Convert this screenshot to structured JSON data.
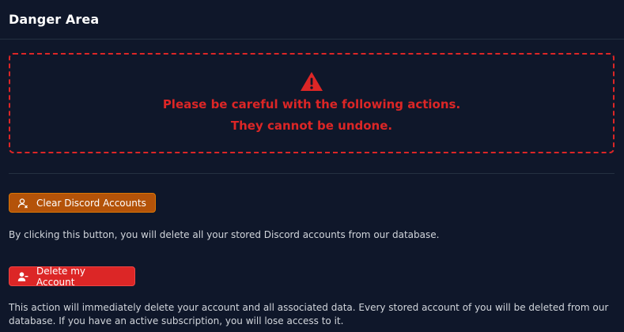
{
  "header": {
    "title": "Danger Area"
  },
  "warning": {
    "line1": "Please be careful with the following actions.",
    "line2": "They cannot be undone.",
    "icon": "warning-triangle-icon",
    "color": "#dc2626"
  },
  "actions": {
    "clear_discord": {
      "label": "Clear Discord Accounts",
      "icon": "user-remove-icon",
      "color": "#b45309",
      "description": "By clicking this button, you will delete all your stored Discord accounts from our database."
    },
    "delete_account": {
      "label": "Delete my Account",
      "icon": "user-minus-icon",
      "color": "#dc2626",
      "description": "This action will immediately delete your account and all associated data. Every stored account of you will be deleted from our database. If you have an active subscription, you will lose access to it."
    }
  }
}
